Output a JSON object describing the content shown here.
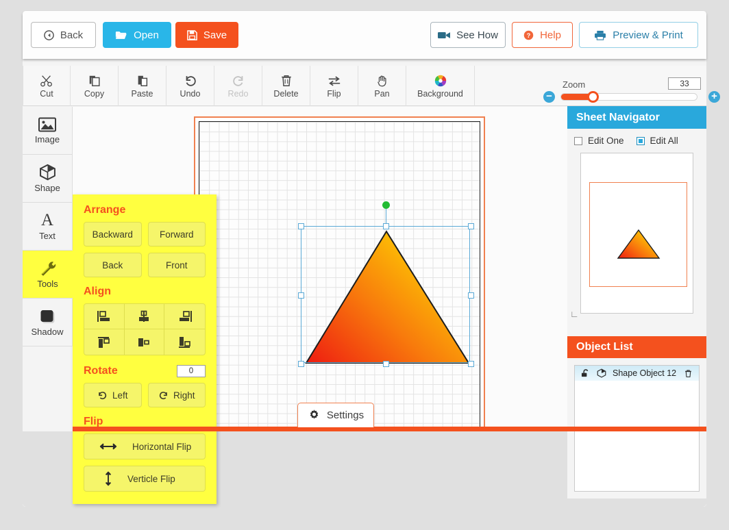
{
  "topbar": {
    "back": "Back",
    "open": "Open",
    "save": "Save",
    "see_how": "See How",
    "help": "Help",
    "preview_print": "Preview & Print"
  },
  "toolbar": {
    "items": [
      {
        "label": "Cut",
        "icon": "scissors-icon",
        "disabled": false
      },
      {
        "label": "Copy",
        "icon": "copy-icon",
        "disabled": false
      },
      {
        "label": "Paste",
        "icon": "paste-icon",
        "disabled": false
      },
      {
        "label": "Undo",
        "icon": "undo-icon",
        "disabled": false
      },
      {
        "label": "Redo",
        "icon": "redo-icon",
        "disabled": true
      },
      {
        "label": "Delete",
        "icon": "trash-icon",
        "disabled": false
      },
      {
        "label": "Flip",
        "icon": "flip-icon",
        "disabled": false
      },
      {
        "label": "Pan",
        "icon": "hand-icon",
        "disabled": false
      },
      {
        "label": "Background",
        "icon": "color-wheel-icon",
        "disabled": false
      }
    ]
  },
  "zoom": {
    "label": "Zoom",
    "value": "33",
    "minus": "−",
    "plus": "+",
    "percent": 33,
    "accent": "#f4511e"
  },
  "rail": {
    "items": [
      {
        "label": "Image",
        "icon": "picture-icon",
        "active": false
      },
      {
        "label": "Shape",
        "icon": "cube-icon",
        "active": false
      },
      {
        "label": "Text",
        "icon": "letter-a-icon",
        "active": false
      },
      {
        "label": "Tools",
        "icon": "wrench-icon",
        "active": true
      },
      {
        "label": "Shadow",
        "icon": "square-icon",
        "active": false
      }
    ]
  },
  "tools": {
    "arrange": {
      "title": "Arrange",
      "buttons": [
        "Backward",
        "Forward",
        "Back",
        "Front"
      ]
    },
    "align": {
      "title": "Align",
      "cells": [
        "align-left-icon",
        "align-center-icon",
        "align-right-icon",
        "align-top-icon",
        "align-middle-icon",
        "align-bottom-icon"
      ]
    },
    "rotate": {
      "title": "Rotate",
      "value": "0",
      "left": "Left",
      "right": "Right"
    },
    "flip": {
      "title": "Flip",
      "horizontal": "Horizontal Flip",
      "vertical": "Verticle Flip"
    }
  },
  "canvas": {
    "settings": "Settings",
    "shape": {
      "name": "triangle",
      "gradient_from": "#ee1c11",
      "gradient_mid": "#f87b0c",
      "gradient_to": "#ffe400",
      "stroke": "#1d1d1d"
    },
    "selection": {
      "rotate_handle_color": "#22bb33",
      "handle_color": "#5aa9d6"
    }
  },
  "sheet_navigator": {
    "title": "Sheet Navigator",
    "edit_one": "Edit One",
    "edit_one_checked": false,
    "edit_all": "Edit All",
    "edit_all_checked": true,
    "resize_corner": "∟"
  },
  "object_list": {
    "title": "Object List",
    "rows": [
      {
        "lock_icon": "unlock-icon",
        "type_icon": "cube-icon",
        "name": "Shape Object 12",
        "delete_icon": "trash-icon"
      }
    ]
  }
}
